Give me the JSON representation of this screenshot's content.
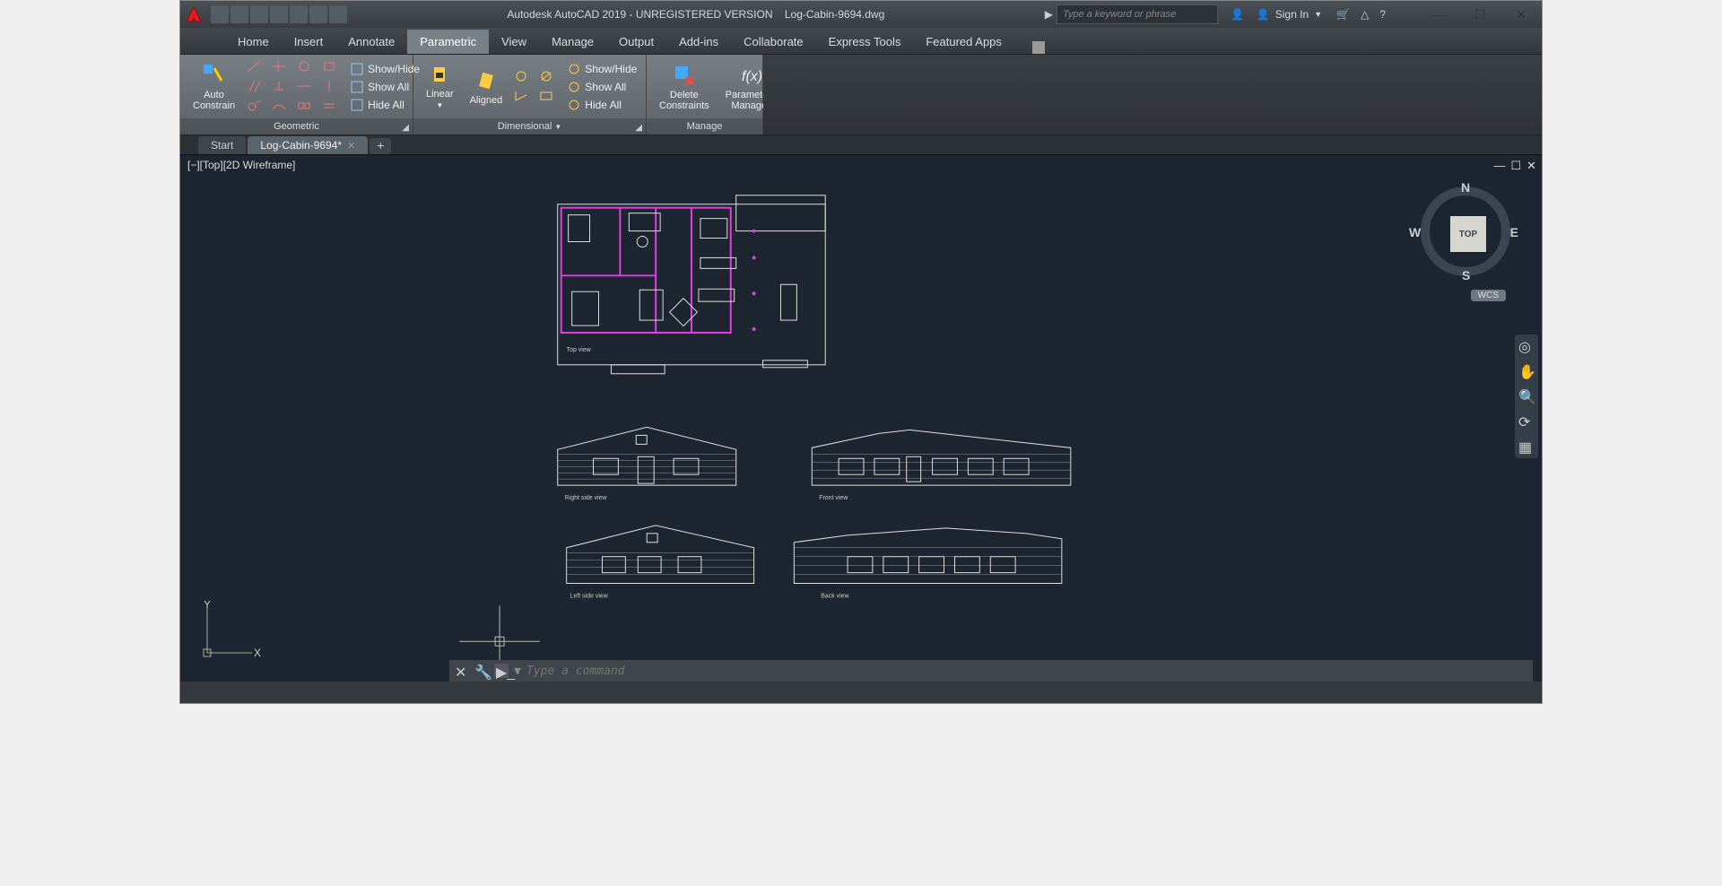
{
  "title": {
    "app": "Autodesk AutoCAD 2019 - UNREGISTERED VERSION",
    "file": "Log-Cabin-9694.dwg"
  },
  "search": {
    "placeholder": "Type a keyword or phrase"
  },
  "signin": {
    "label": "Sign In"
  },
  "menu_tabs": [
    "Home",
    "Insert",
    "Annotate",
    "Parametric",
    "View",
    "Manage",
    "Output",
    "Add-ins",
    "Collaborate",
    "Express Tools",
    "Featured Apps"
  ],
  "menu_active": "Parametric",
  "ribbon": {
    "geometric": {
      "title": "Geometric",
      "auto": "Auto\nConstrain",
      "showhide": "Show/Hide",
      "showall": "Show All",
      "hideall": "Hide All"
    },
    "dimensional": {
      "title": "Dimensional",
      "linear": "Linear",
      "aligned": "Aligned",
      "showhide": "Show/Hide",
      "showall": "Show All",
      "hideall": "Hide All"
    },
    "manage": {
      "title": "Manage",
      "delete": "Delete\nConstraints",
      "params": "Parameters\nManager"
    }
  },
  "file_tabs": {
    "start": "Start",
    "current": "Log-Cabin-9694*"
  },
  "viewport": {
    "label": "[−][Top][2D Wireframe]"
  },
  "viewcube": {
    "top": "TOP",
    "n": "N",
    "s": "S",
    "e": "E",
    "w": "W"
  },
  "wcs": "WCS",
  "drawing_labels": {
    "top": "Top view",
    "right": "Right side view",
    "front": "Front view",
    "left": "Left side view",
    "back": "Back view"
  },
  "ucs": {
    "x": "X",
    "y": "Y"
  },
  "cmdline": {
    "placeholder": "Type a command"
  }
}
